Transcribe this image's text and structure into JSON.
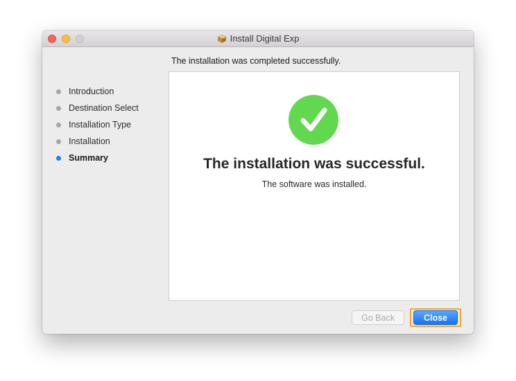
{
  "window": {
    "title": "Install Digital Exp",
    "title_icon": "package-icon"
  },
  "header": {
    "text": "The installation was completed successfully."
  },
  "sidebar": {
    "steps": [
      {
        "label": "Introduction",
        "active": false
      },
      {
        "label": "Destination Select",
        "active": false
      },
      {
        "label": "Installation Type",
        "active": false
      },
      {
        "label": "Installation",
        "active": false
      },
      {
        "label": "Summary",
        "active": true
      }
    ]
  },
  "main": {
    "icon": "checkmark-success-icon",
    "title": "The installation was successful.",
    "subtitle": "The software was installed."
  },
  "buttons": {
    "go_back": {
      "label": "Go Back",
      "enabled": false
    },
    "close": {
      "label": "Close",
      "default": true,
      "focused": true
    }
  },
  "colors": {
    "success_green": "#62d84e",
    "accent_blue": "#1a82fb",
    "focus_orange": "#f5a623"
  }
}
